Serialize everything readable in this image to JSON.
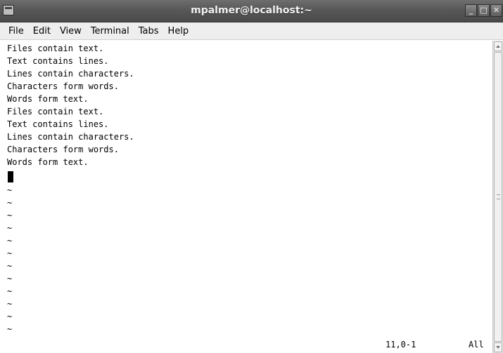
{
  "window": {
    "title": "mpalmer@localhost:~",
    "controls": {
      "minimize": "_",
      "maximize": "□",
      "close": "✕"
    }
  },
  "menu": {
    "file": "File",
    "edit": "Edit",
    "view": "View",
    "terminal": "Terminal",
    "tabs": "Tabs",
    "help": "Help"
  },
  "buffer": {
    "lines": [
      "Files contain text.",
      "Text contains lines.",
      "Lines contain characters.",
      "Characters form words.",
      "Words form text.",
      "Files contain text.",
      "Text contains lines.",
      "Lines contain characters.",
      "Characters form words.",
      "Words form text."
    ],
    "tildes": [
      "~",
      "~",
      "~",
      "~",
      "~",
      "~",
      "~",
      "~",
      "~",
      "~",
      "~",
      "~"
    ]
  },
  "status": {
    "position": "11,0-1",
    "scroll": "All"
  }
}
